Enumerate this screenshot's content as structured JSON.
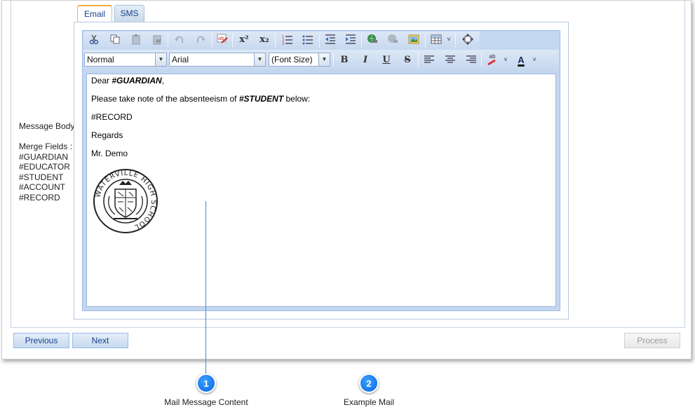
{
  "tabs": [
    {
      "label": "Email",
      "active": true
    },
    {
      "label": "SMS",
      "active": false
    }
  ],
  "left_panel": {
    "message_body_label": "Message Body",
    "merge_fields_label": "Merge Fields :",
    "merge_fields": [
      "#GUARDIAN",
      "#EDUCATOR",
      "#STUDENT",
      "#ACCOUNT",
      "#RECORD"
    ]
  },
  "toolbar": {
    "format_value": "Normal",
    "font_value": "Arial",
    "size_value": "(Font Size)",
    "bold": "B",
    "italic": "I",
    "underline": "U",
    "strike": "S",
    "superscript": "x²",
    "subscript": "x₂",
    "font_color_letter": "A",
    "highlight_letter": "ab"
  },
  "editor_content": {
    "line1_prefix": "Dear ",
    "line1_field": "#GUARDIAN",
    "line1_suffix": ",",
    "line2_prefix": "Please take note of the absenteeism of ",
    "line2_field": "#STUDENT",
    "line2_suffix": " below:",
    "line3": "#RECORD",
    "line4": "Regards",
    "line5": "Mr. Demo",
    "crest_text": "WATERVILLE HIGH SCHOOL"
  },
  "buttons": {
    "previous": "Previous",
    "next": "Next",
    "process": "Process"
  },
  "callouts": [
    {
      "number": "1",
      "label": "Mail Message Content"
    },
    {
      "number": "2",
      "label": "Example Mail"
    }
  ],
  "colors": {
    "accent": "#15428b",
    "callout": "#0b66e4",
    "tab_highlight": "#f7a940"
  }
}
